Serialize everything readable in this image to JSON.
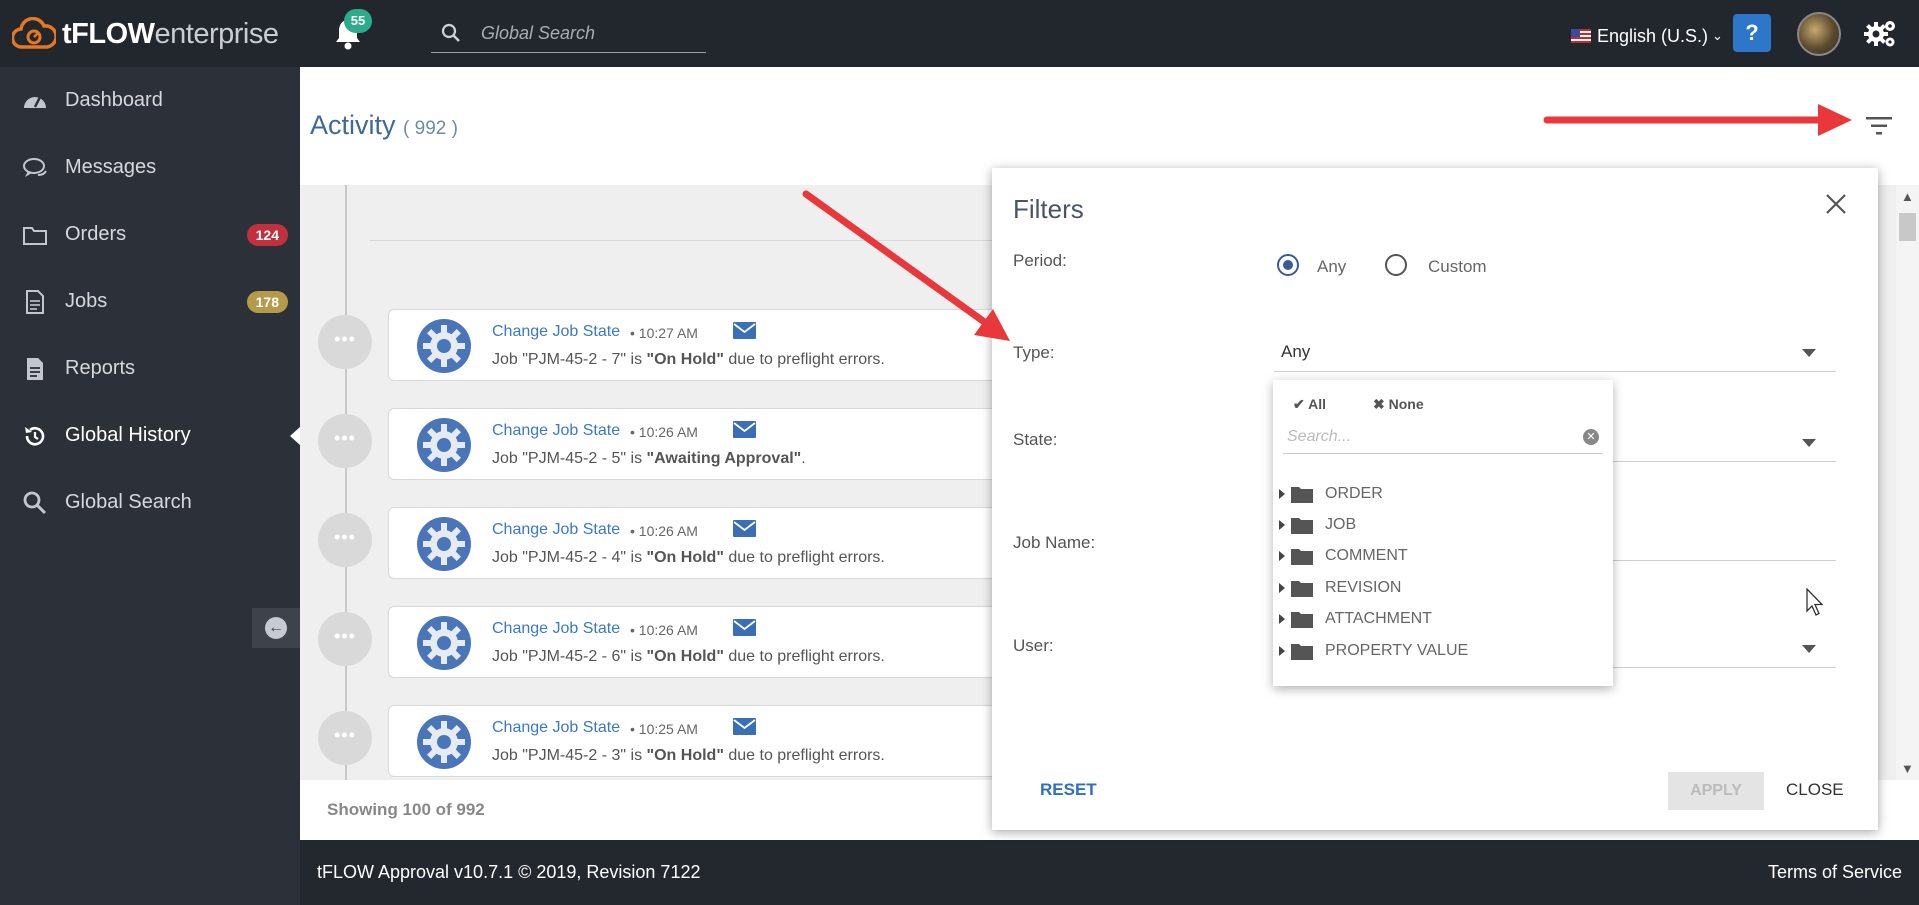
{
  "header": {
    "logo_brand": "tFLOW",
    "logo_suffix": "enterprise",
    "notification_count": "55",
    "search_placeholder": "Global Search",
    "language": "English (U.S.)",
    "help_glyph": "?"
  },
  "sidebar": {
    "items": [
      {
        "label": "Dashboard",
        "icon": "dashboard-icon"
      },
      {
        "label": "Messages",
        "icon": "messages-icon"
      },
      {
        "label": "Orders",
        "icon": "folder-icon",
        "badge": "124",
        "badge_color": "#c0303d"
      },
      {
        "label": "Jobs",
        "icon": "document-icon",
        "badge": "178",
        "badge_color": "#b59a4a"
      },
      {
        "label": "Reports",
        "icon": "report-icon"
      },
      {
        "label": "Global History",
        "icon": "history-icon",
        "active": true
      },
      {
        "label": "Global Search",
        "icon": "search-icon"
      }
    ]
  },
  "main": {
    "title": "Activity",
    "count": "( 992 )",
    "showing": "Showing 100 of 992"
  },
  "activities": [
    {
      "title": "Change Job State",
      "time": "• 10:27 AM",
      "job": "Job \"PJM-45-2 - 7\" is ",
      "state": "\"On Hold\"",
      "suffix": " due to preflight errors."
    },
    {
      "title": "Change Job State",
      "time": "• 10:26 AM",
      "job": "Job \"PJM-45-2 - 5\" is ",
      "state": "\"Awaiting Approval\"",
      "suffix": "."
    },
    {
      "title": "Change Job State",
      "time": "• 10:26 AM",
      "job": "Job \"PJM-45-2 - 4\" is ",
      "state": "\"On Hold\"",
      "suffix": " due to preflight errors."
    },
    {
      "title": "Change Job State",
      "time": "• 10:26 AM",
      "job": "Job \"PJM-45-2 - 6\" is ",
      "state": "\"On Hold\"",
      "suffix": " due to preflight errors."
    },
    {
      "title": "Change Job State",
      "time": "• 10:25 AM",
      "job": "Job \"PJM-45-2 - 3\" is ",
      "state": "\"On Hold\"",
      "suffix": " due to preflight errors."
    }
  ],
  "filters": {
    "title": "Filters",
    "period_label": "Period:",
    "period_any": "Any",
    "period_custom": "Custom",
    "period_selected": "Any",
    "type_label": "Type:",
    "type_value": "Any",
    "state_label": "State:",
    "job_name_label": "Job Name:",
    "user_label": "User:",
    "reset": "RESET",
    "apply": "APPLY",
    "close": "CLOSE"
  },
  "type_dropdown": {
    "all": "All",
    "none": "None",
    "search_placeholder": "Search...",
    "nodes": [
      "ORDER",
      "JOB",
      "COMMENT",
      "REVISION",
      "ATTACHMENT",
      "PROPERTY VALUE"
    ]
  },
  "footer": {
    "version": "tFLOW Approval v10.7.1 © 2019, Revision 7122",
    "terms": "Terms of Service"
  },
  "colors": {
    "topbar": "#22272e",
    "sidebar": "#2c3038",
    "accent_link": "#3a7ac4",
    "annotation_arrow": "#e8383b"
  }
}
